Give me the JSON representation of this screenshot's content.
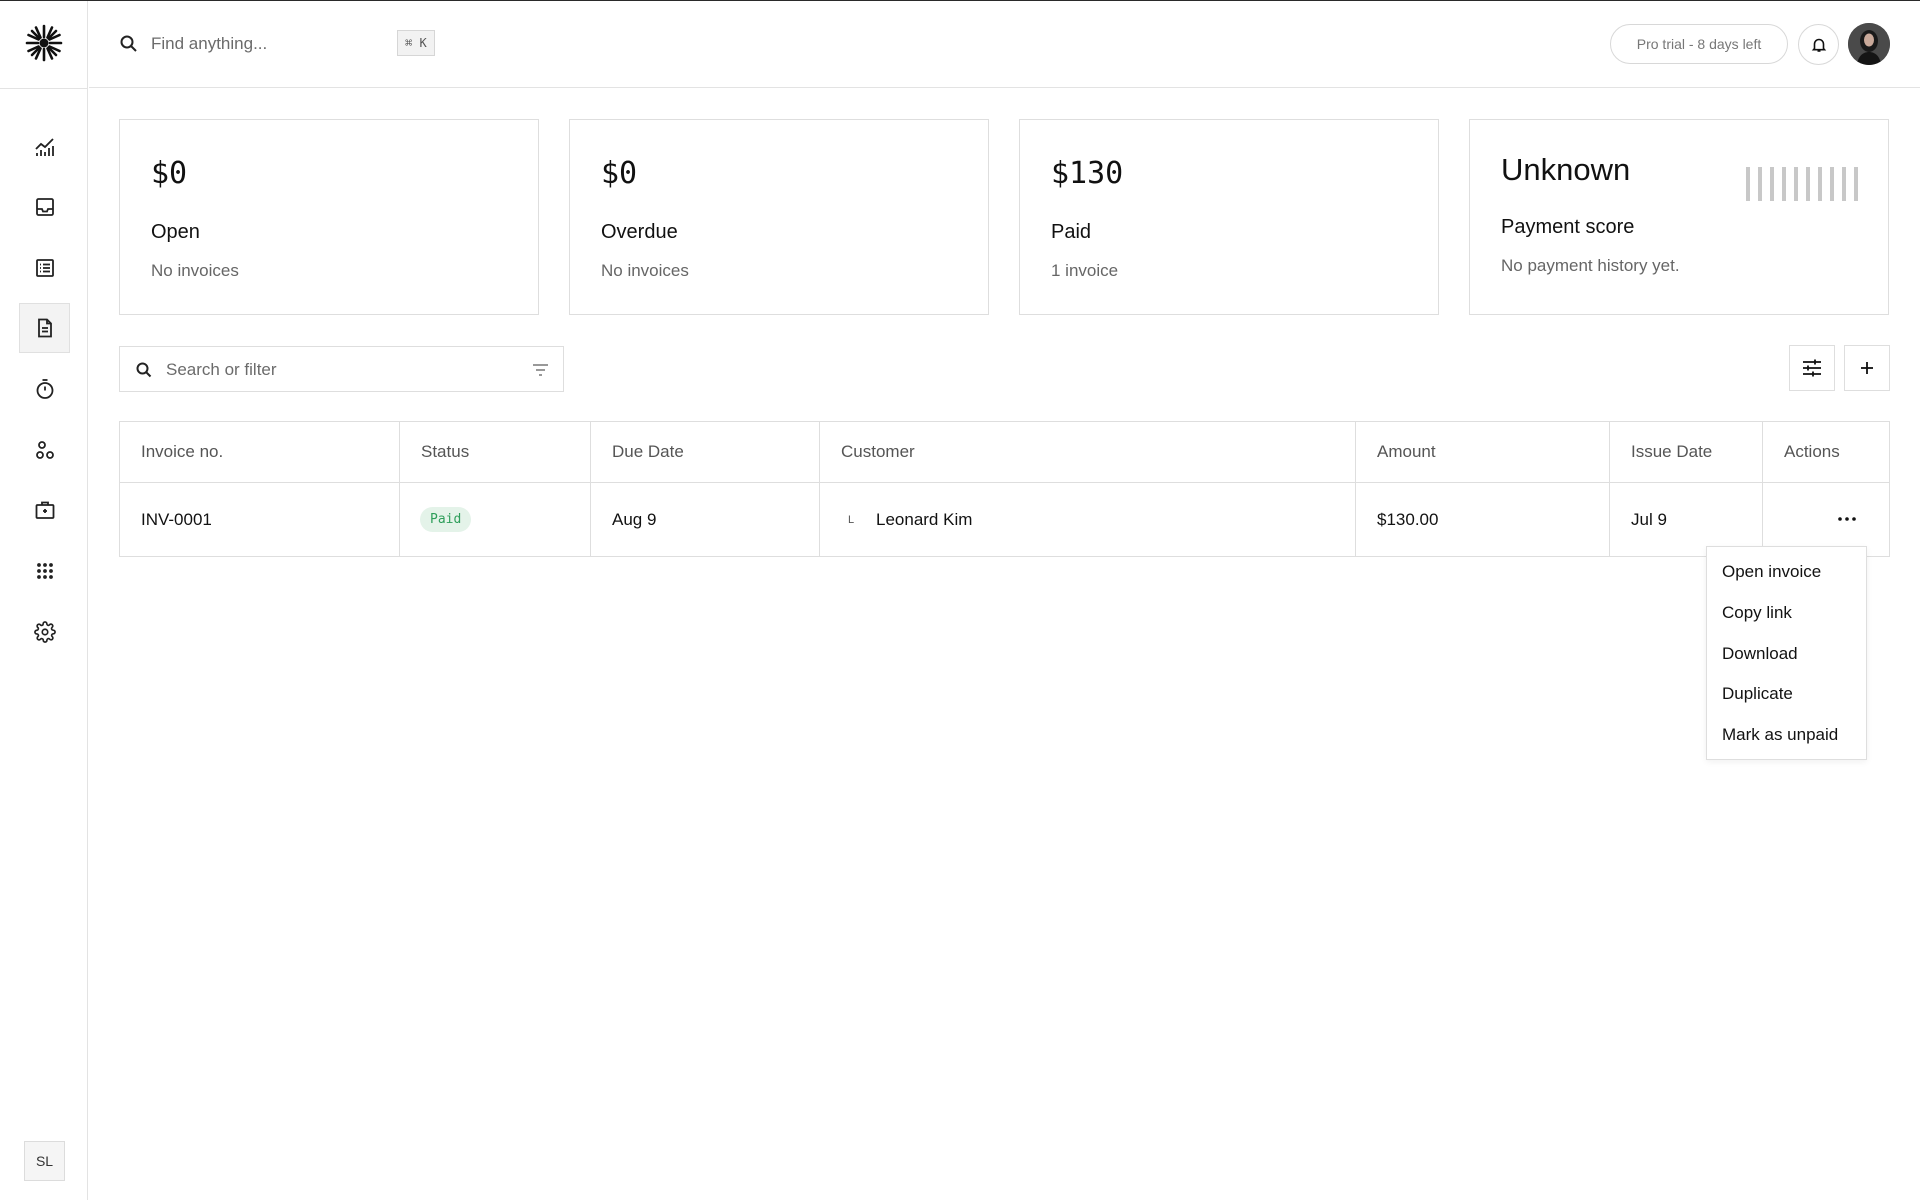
{
  "header": {
    "search_placeholder": "Find anything...",
    "shortcut": "⌘ K",
    "trial_label": "Pro trial - 8 days left"
  },
  "sidebar": {
    "items": [
      {
        "icon": "chart-icon"
      },
      {
        "icon": "inbox-icon"
      },
      {
        "icon": "transactions-icon"
      },
      {
        "icon": "invoice-icon",
        "active": true
      },
      {
        "icon": "timer-icon"
      },
      {
        "icon": "customers-icon"
      },
      {
        "icon": "vault-icon"
      },
      {
        "icon": "apps-icon"
      },
      {
        "icon": "settings-icon"
      }
    ],
    "user_initials": "SL"
  },
  "summary": {
    "open": {
      "amount": "$0",
      "label": "Open",
      "sub": "No invoices"
    },
    "overdue": {
      "amount": "$0",
      "label": "Overdue",
      "sub": "No invoices"
    },
    "paid": {
      "amount": "$130",
      "label": "Paid",
      "sub": "1 invoice"
    },
    "score": {
      "amount": "Unknown",
      "label": "Payment score",
      "sub": "No payment history yet."
    }
  },
  "filter": {
    "placeholder": "Search or filter"
  },
  "table": {
    "headers": {
      "invoice_no": "Invoice no.",
      "status": "Status",
      "due_date": "Due Date",
      "customer": "Customer",
      "amount": "Amount",
      "issue_date": "Issue Date",
      "actions": "Actions"
    },
    "rows": [
      {
        "invoice_no": "INV-0001",
        "status": "Paid",
        "due_date": "Aug 9",
        "customer_initial": "L",
        "customer": "Leonard Kim",
        "amount": "$130.00",
        "issue_date": "Jul 9"
      }
    ]
  },
  "menu": {
    "items": [
      "Open invoice",
      "Copy link",
      "Download",
      "Duplicate",
      "Mark as unpaid"
    ]
  },
  "colors": {
    "paid_text": "#2e9e5a",
    "paid_bg": "#e4f3e9",
    "border": "#dedede"
  }
}
